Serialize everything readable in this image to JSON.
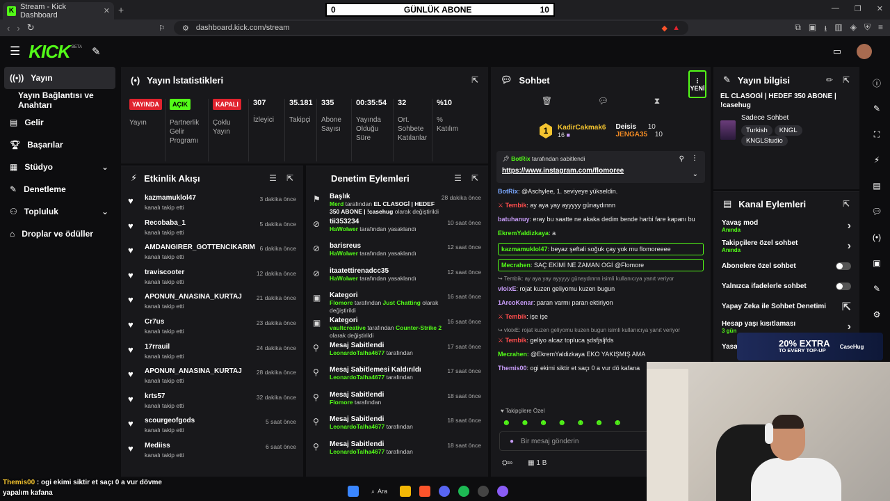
{
  "browser": {
    "tab_title": "Stream - Kick Dashboard",
    "url": "dashboard.kick.com/stream"
  },
  "overlay": {
    "sub_left": "0",
    "sub_label": "GÜNLÜK ABONE",
    "sub_right": "10"
  },
  "brand": {
    "logo": "KICK",
    "beta": "BETA",
    "accent": "#53fc18"
  },
  "sidebar": {
    "items": [
      {
        "label": "Yayın",
        "icon": "broadcast-icon",
        "active": true
      },
      {
        "label": "Yayın Bağlantısı ve Anahtarı",
        "icon": ""
      },
      {
        "label": "Gelir",
        "icon": "dollar-icon"
      },
      {
        "label": "Başarılar",
        "icon": "trophy-icon"
      },
      {
        "label": "Stüdyo",
        "icon": "studio-icon",
        "chevron": true
      },
      {
        "label": "Denetleme",
        "icon": "wrench-icon"
      },
      {
        "label": "Topluluk",
        "icon": "users-icon",
        "chevron": true
      },
      {
        "label": "Droplar ve ödüller",
        "icon": "gift-icon"
      }
    ]
  },
  "stats": {
    "title": "Yayın İstatistikleri",
    "items": [
      {
        "badge": "YAYINDA",
        "badge_color": "#e0232e",
        "label": "Yayın"
      },
      {
        "badge": "AÇIK",
        "badge_color": "#53fc18",
        "label": "Partnerlik Gelir Programı"
      },
      {
        "badge": "KAPALI",
        "badge_color": "#e0232e",
        "label": "Çoklu Yayın"
      },
      {
        "value": "307",
        "label": "İzleyici"
      },
      {
        "value": "35.181",
        "label": "Takipçi"
      },
      {
        "value": "335",
        "label": "Abone Sayısı"
      },
      {
        "value": "00:35:54",
        "label": "Yayında Olduğu Süre"
      },
      {
        "value": "32",
        "label": "Ort. Sohbete Katılanlar"
      },
      {
        "value": "%10",
        "label": "% Katılım"
      }
    ]
  },
  "activity": {
    "title": "Etkinlik Akışı",
    "sub": "kanalı takip etti",
    "items": [
      {
        "name": "kazmamuklol47",
        "time": "3 dakika önce"
      },
      {
        "name": "Recobaba_1",
        "time": "5 dakika önce"
      },
      {
        "name": "AMDANGIRER_GOTTENCIKARIM",
        "time": "6 dakika önce"
      },
      {
        "name": "traviscooter",
        "time": "12 dakika önce"
      },
      {
        "name": "APONUN_ANASINA_KURTAJ",
        "time": "21 dakika önce"
      },
      {
        "name": "Cr7us",
        "time": "23 dakika önce"
      },
      {
        "name": "17rrauil",
        "time": "24 dakika önce"
      },
      {
        "name": "APONUN_ANASINA_KURTAJ",
        "time": "28 dakika önce"
      },
      {
        "name": "krts57",
        "time": "32 dakika önce"
      },
      {
        "name": "scourgeofgods",
        "time": "5 saat önce"
      },
      {
        "name": "Mediiss",
        "time": "6 saat önce"
      }
    ]
  },
  "moderation": {
    "title": "Denetim Eylemleri",
    "items": [
      {
        "icon": "⚑",
        "title": "Başlık",
        "time": "28 dakika önce",
        "user": "Merd",
        "d1": " tarafından ",
        "d2": "EL CLASOGİ | HEDEF 350 ABONE | !casehug",
        "d3": " olarak değiştirildi"
      },
      {
        "icon": "⊘",
        "title": "tii353234",
        "time": "10 saat önce",
        "user": "HaWolwer",
        "d1": " tarafından yasaklandı",
        "d2": "",
        "d3": ""
      },
      {
        "icon": "⊘",
        "title": "barisreus",
        "time": "12 saat önce",
        "user": "HaWolwer",
        "d1": " tarafından yasaklandı",
        "d2": "",
        "d3": ""
      },
      {
        "icon": "⊘",
        "title": "itaatettirenadcc35",
        "time": "12 saat önce",
        "user": "HaWolwer",
        "d1": " tarafından yasaklandı",
        "d2": "",
        "d3": ""
      },
      {
        "icon": "▣",
        "title": "Kategori",
        "time": "16 saat önce",
        "user": "Flomore",
        "d1": " tarafından ",
        "d2": "Just Chatting",
        "d3": " olarak değiştirildi"
      },
      {
        "icon": "▣",
        "title": "Kategori",
        "time": "16 saat önce",
        "user": "vaultcreative",
        "d1": " tarafından ",
        "d2": "Counter-Strike 2",
        "d3": " olarak değiştirildi"
      },
      {
        "icon": "⚲",
        "title": "Mesaj Sabitlendi",
        "time": "17 saat önce",
        "user": "LeonardoTalha4677",
        "d1": " tarafından",
        "d2": "",
        "d3": ""
      },
      {
        "icon": "⚲",
        "title": "Mesaj Sabitlemesi Kaldırıldı",
        "time": "17 saat önce",
        "user": "LeonardoTalha4677",
        "d1": " tarafından",
        "d2": "",
        "d3": ""
      },
      {
        "icon": "⚲",
        "title": "Mesaj Sabitlendi",
        "time": "18 saat önce",
        "user": "Flomore",
        "d1": " tarafından",
        "d2": "",
        "d3": ""
      },
      {
        "icon": "⚲",
        "title": "Mesaj Sabitlendi",
        "time": "18 saat önce",
        "user": "LeonardoTalha4677",
        "d1": " tarafından",
        "d2": "",
        "d3": ""
      },
      {
        "icon": "⚲",
        "title": "Mesaj Sabitlendi",
        "time": "18 saat önce",
        "user": "LeonardoTalha4677",
        "d1": " tarafından",
        "d2": "",
        "d3": ""
      }
    ]
  },
  "chat": {
    "title": "Sohbet",
    "new": "YENİ",
    "gifters": {
      "top_name": "KadirCakmak6",
      "top_count": "16",
      "second_name": "Deisis",
      "second_count": "10",
      "third_name": "JENGA35",
      "third_count": "10",
      "rank": "1"
    },
    "pinned": {
      "by": "BotRix",
      "by_suffix": " tarafından sabitlendi",
      "link": "https://www.instagram.com/flomoree"
    },
    "messages": [
      {
        "user": "BotRix",
        "cls": "u-blue",
        "text": ": @Aschylee, 1. seviyeye yükseldin.",
        "type": ""
      },
      {
        "user": "Tembik",
        "cls": "u-red",
        "text": ": ay aya yay ayyyyy günaydınnn",
        "type": ""
      },
      {
        "user": "batuhanuy",
        "cls": "u-purple",
        "text": ": eray bu saatte ne akaka dedim bende harbi fare kapanı bu",
        "type": ""
      },
      {
        "user": "EkremYaldizkaya",
        "cls": "u-green",
        "text": ": a",
        "type": ""
      },
      {
        "user": "kazmamuklol47",
        "cls": "u-green",
        "text": ": beyaz şeftali soğuk çay yok mu flomoreeee",
        "type": "hl"
      },
      {
        "user": "Mecrahen",
        "cls": "u-green",
        "text": ": SAÇ EKİMİ NE ZAMAN OGİ @Flomore",
        "type": "hl"
      },
      {
        "user": "",
        "cls": "",
        "text": "↪ Tembik: ay aya yay ayyyyy günaydınnn isimli kullanıcıya yanıt veriyor",
        "type": "small"
      },
      {
        "user": "vloixE",
        "cls": "u-purple",
        "text": ": rojat kuzen geliyomu kuzen bugun",
        "type": ""
      },
      {
        "user": "1ArcoKenar",
        "cls": "u-purple",
        "text": ": paran varmı paran ektiriyon",
        "type": ""
      },
      {
        "user": "Tembik",
        "cls": "u-red",
        "text": ": işe işe",
        "type": ""
      },
      {
        "user": "",
        "cls": "",
        "text": "↪ vloixE: rojat kuzen geliyomu kuzen bugun isimli kullanıcıya yanıt veriyor",
        "type": "small"
      },
      {
        "user": "Tembik",
        "cls": "u-red",
        "text": ": geliyo alcaz topluca şdsfjsljfds",
        "type": ""
      },
      {
        "user": "Mecrahen",
        "cls": "u-green",
        "text": ": @EkremYaldizkaya EKO YAKIŞMIŞ AMA",
        "type": ""
      },
      {
        "user": "Themis00",
        "cls": "u-purple",
        "text": ": ogi ekimi siktir et saçı 0 a vur dö kafana",
        "type": ""
      }
    ],
    "followers_only": "♥ Takipçilere Özel",
    "placeholder": "Bir mesaj gönderin",
    "bottom_count": "1 B"
  },
  "info": {
    "title": "Yayın bilgisi",
    "stream_title": "EL CLASOGİ | HEDEF 350 ABONE | !casehug",
    "category": "Sadece Sohbet",
    "tags": [
      "Turkish",
      "KNGL",
      "KNGLStudio"
    ]
  },
  "channel_actions": {
    "title": "Kanal Eylemleri",
    "items": [
      {
        "label": "Yavaş mod",
        "sub": "Anında",
        "kind": "arrow"
      },
      {
        "label": "Takipçilere özel sohbet",
        "sub": "Anında",
        "kind": "arrow"
      },
      {
        "label": "Abonelere özel sohbet",
        "sub": "",
        "kind": "toggle"
      },
      {
        "label": "Yalnızca ifadelerle sohbet",
        "sub": "",
        "kind": "toggle"
      },
      {
        "label": "Yapay Zeka ile Sohbet Denetimi",
        "sub": "",
        "kind": "ext"
      },
      {
        "label": "Hesap yaşı kısıtlaması",
        "sub": "3 gün",
        "kind": "arrow"
      },
      {
        "label": "Yasak",
        "sub": "",
        "kind": "arrow"
      }
    ]
  },
  "promo": {
    "line1": "20% EXTRA",
    "line2": "TO EVERY TOP-UP",
    "brand": "CaseHug"
  },
  "overlay_chat": {
    "user": "Themis00",
    "text": " : ogi ekimi siktir et saçı 0 a vur dövme yapalım kafana"
  },
  "taskbar": {
    "search": "Ara"
  }
}
